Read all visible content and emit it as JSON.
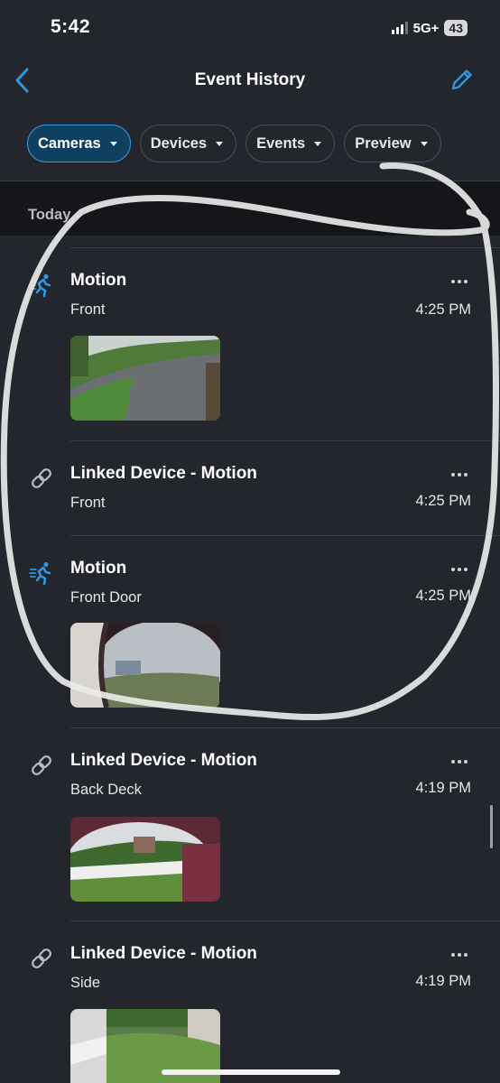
{
  "status_bar": {
    "time": "5:42",
    "network": "5G+",
    "battery": "43"
  },
  "nav": {
    "title": "Event History",
    "back_icon": "chevron-left-icon",
    "edit_icon": "pencil-icon"
  },
  "filters": [
    {
      "label": "Cameras",
      "active": true
    },
    {
      "label": "Devices",
      "active": false
    },
    {
      "label": "Events",
      "active": false
    },
    {
      "label": "Preview",
      "active": false
    }
  ],
  "section": {
    "label": "Today"
  },
  "events": [
    {
      "icon": "motion-runner-icon",
      "title": "Motion",
      "device": "Front",
      "time": "4:25 PM",
      "has_thumb": true
    },
    {
      "icon": "link-icon",
      "title": "Linked Device - Motion",
      "device": "Front",
      "time": "4:25 PM",
      "has_thumb": false
    },
    {
      "icon": "motion-runner-icon",
      "title": "Motion",
      "device": "Front Door",
      "time": "4:25 PM",
      "has_thumb": true
    },
    {
      "icon": "link-icon",
      "title": "Linked Device - Motion",
      "device": "Back Deck",
      "time": "4:19 PM",
      "has_thumb": true
    },
    {
      "icon": "link-icon",
      "title": "Linked Device - Motion",
      "device": "Side",
      "time": "4:19 PM",
      "has_thumb": true
    }
  ],
  "colors": {
    "background": "#23272d",
    "section_background": "#141619",
    "accent": "#3a9be0",
    "active_chip": "#10405f"
  }
}
